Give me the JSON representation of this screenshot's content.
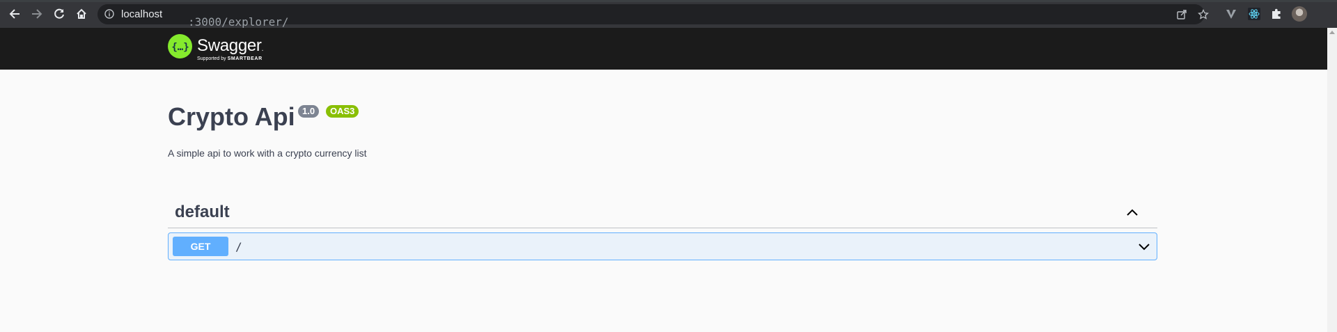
{
  "browser": {
    "url_host": "localhost",
    "url_path": ":3000/explorer/",
    "icons": [
      "back-arrow-icon",
      "forward-arrow-icon",
      "reload-icon",
      "home-icon",
      "info-icon",
      "share-icon",
      "star-icon",
      "extension-v-icon",
      "react-devtools-icon",
      "puzzle-icon",
      "profile-avatar"
    ]
  },
  "swagger": {
    "brand_name": "Swagger",
    "brand_tm": ".",
    "supported_by": "Supported by",
    "smartbear": "SMARTBEAR",
    "brand_color": "#85ea2d"
  },
  "info": {
    "title": "Crypto Api",
    "version": "1.0",
    "oas": "OAS3",
    "description": "A simple api to work with a crypto currency list"
  },
  "tag": {
    "name": "default",
    "expanded": true
  },
  "operations": [
    {
      "method": "GET",
      "path": "/",
      "method_color": "#61affe"
    }
  ]
}
